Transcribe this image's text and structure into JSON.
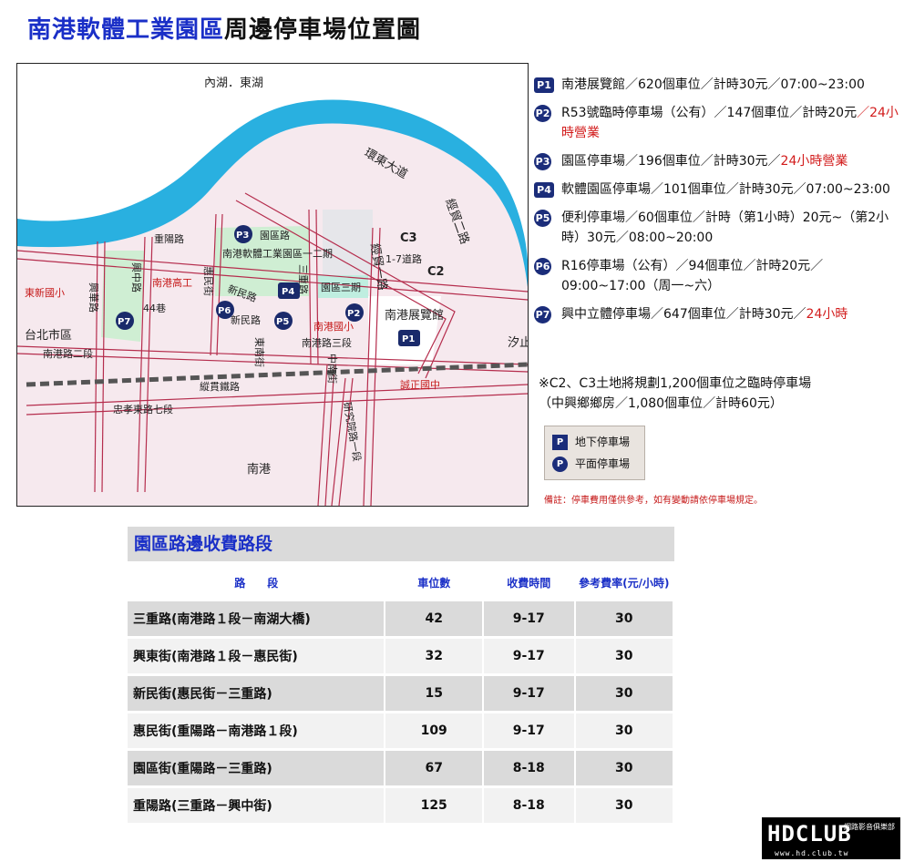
{
  "title": {
    "part1": "南港軟體工業園區",
    "part2": "周邊停車場位置圖"
  },
  "map": {
    "labels": {
      "neihu": "內湖．東湖",
      "huandong": "環東大道",
      "jingmao2": "經貿二路",
      "jingmao1": "經貿一路",
      "c3": "C3",
      "c2": "C2",
      "alley": "1-7道路",
      "nangang_hall": "南港展覽館",
      "yuanqu_lu": "園區路",
      "sanqi": "園區三期",
      "sanchong": "三重路",
      "software_park": "南港軟體工業園區一二期",
      "zhongyang": "重陽路",
      "xingzhong": "興中路",
      "xinghua": "興華路",
      "nangang_hs": "南港高工",
      "huimin": "惠民街",
      "xinmin1": "新民路",
      "xinmin2": "新民路",
      "alley44": "44巷",
      "dongxin": "東新國小",
      "taipei": "台北市區",
      "nangang_rd2": "南港路二段",
      "nangang_rd3": "南港路三段",
      "nangang_es": "南港國小",
      "xingnan": "東南街",
      "zhongnan": "中南街",
      "zongguan": "縱貫鐵路",
      "zhongxiao": "忠孝東路七段",
      "chengzheng": "誠正國中",
      "yanjiu": "研究院路一段",
      "nangang": "南港",
      "xizhi": "汐止"
    },
    "markers": [
      "P1",
      "P2",
      "P3",
      "P4",
      "P5",
      "P6",
      "P7"
    ]
  },
  "parking": [
    {
      "badge": "P1",
      "text": "南港展覽館／620個車位／計時30元／07:00~23:00",
      "highlight": "",
      "tail": ""
    },
    {
      "badge": "P2",
      "text": "R53號臨時停車場（公有）／147個車位／計時20元",
      "highlight": "／24小時營業",
      "tail": ""
    },
    {
      "badge": "P3",
      "text": "園區停車場／196個車位／計時30元／",
      "highlight": "24小時營業",
      "tail": ""
    },
    {
      "badge": "P4",
      "text": "軟體園區停車場／101個車位／計時30元／07:00~23:00",
      "highlight": "",
      "tail": ""
    },
    {
      "badge": "P5",
      "text": "便利停車場／60個車位／計時（第1小時）20元~（第2小時）30元／08:00~20:00",
      "highlight": "",
      "tail": ""
    },
    {
      "badge": "P6",
      "text": "R16停車場（公有）／94個車位／計時20元／09:00~17:00（周一~六）",
      "highlight": "",
      "tail": ""
    },
    {
      "badge": "P7",
      "text": "興中立體停車場／647個車位／計時30元／",
      "highlight": "24小時",
      "tail": ""
    }
  ],
  "note": {
    "line1": "※C2、C3土地將規劃1,200個車位之臨時停車場",
    "line2": "（中興鄉鄉房／1,080個車位／計時60元）"
  },
  "legend": {
    "underground": "地下停車場",
    "surface": "平面停車場",
    "p": "P"
  },
  "remark": "備註：停車費用僅供參考，如有變動請依停車場規定。",
  "table": {
    "title": "園區路邊收費路段",
    "headers": {
      "road": "路　　段",
      "spaces": "車位數",
      "hours": "收費時間",
      "rate": "參考費率(元/小時)"
    },
    "rows": [
      {
        "road": "三重路(南港路１段－南湖大橋)",
        "spaces": "42",
        "hours": "9-17",
        "rate": "30"
      },
      {
        "road": "興東街(南港路１段－惠民街)",
        "spaces": "32",
        "hours": "9-17",
        "rate": "30"
      },
      {
        "road": "新民街(惠民街－三重路)",
        "spaces": "15",
        "hours": "9-17",
        "rate": "30"
      },
      {
        "road": "惠民街(重陽路－南港路１段)",
        "spaces": "109",
        "hours": "9-17",
        "rate": "30"
      },
      {
        "road": "園區街(重陽路－三重路)",
        "spaces": "67",
        "hours": "8-18",
        "rate": "30"
      },
      {
        "road": "重陽路(三重路－興中街)",
        "spaces": "125",
        "hours": "8-18",
        "rate": "30"
      }
    ]
  },
  "logo": {
    "main": "HDCLUB",
    "small": "網路影音俱樂部",
    "url": "www.hd.club.tw"
  },
  "colors": {
    "title_blue": "#1a2fc7",
    "badge_navy": "#1b2d7a",
    "river": "#29b0e0",
    "highlight_red": "#d21b1b",
    "park_green": "#cfeed3"
  }
}
